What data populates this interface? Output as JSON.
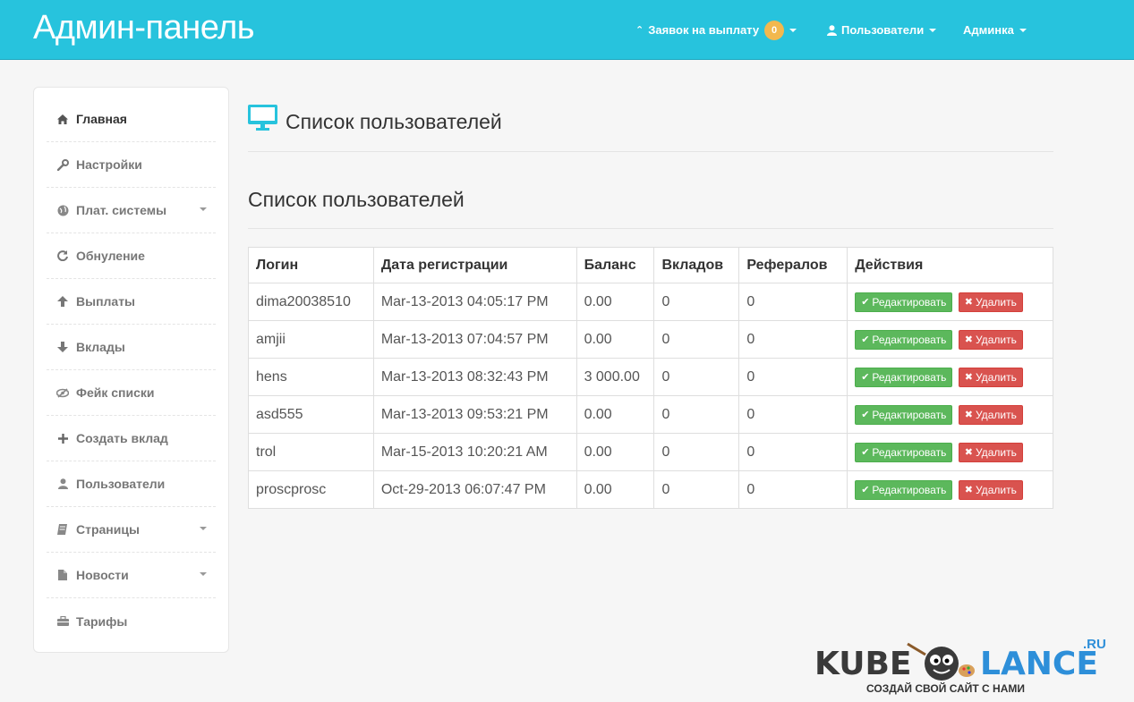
{
  "brand": "Админ-панель",
  "nav": {
    "payouts_label": "Заявок на выплату",
    "payouts_count": "0",
    "users_label": "Пользователи",
    "admin_label": "Админка"
  },
  "sidebar": {
    "items": [
      {
        "label": "Главная",
        "icon": "home-icon"
      },
      {
        "label": "Настройки",
        "icon": "wrench-icon"
      },
      {
        "label": "Плат. системы",
        "icon": "globe-icon"
      },
      {
        "label": "Обнуление",
        "icon": "refresh-icon"
      },
      {
        "label": "Выплаты",
        "icon": "arrow-up-icon"
      },
      {
        "label": "Вклады",
        "icon": "arrow-down-icon"
      },
      {
        "label": "Фейк списки",
        "icon": "eye-slash-icon"
      },
      {
        "label": "Создать вклад",
        "icon": "plus-icon"
      },
      {
        "label": "Пользователи",
        "icon": "user-icon"
      },
      {
        "label": "Страницы",
        "icon": "book-icon"
      },
      {
        "label": "Новости",
        "icon": "file-icon"
      },
      {
        "label": "Тарифы",
        "icon": "briefcase-icon"
      }
    ]
  },
  "main": {
    "page_title": "Список пользователей",
    "section_title": "Список пользователей",
    "table": {
      "headers": [
        "Логин",
        "Дата регистрации",
        "Баланс",
        "Вкладов",
        "Рефералов",
        "Действия"
      ],
      "edit_label": "Редактировать",
      "delete_label": "Удалить",
      "rows": [
        [
          "dima20038510",
          "Mar-13-2013 04:05:17 PM",
          "0.00",
          "0",
          "0"
        ],
        [
          "amjii",
          "Mar-13-2013 07:04:57 PM",
          "0.00",
          "0",
          "0"
        ],
        [
          "hens",
          "Mar-13-2013 08:32:43 PM",
          "3 000.00",
          "0",
          "0"
        ],
        [
          "asd555",
          "Mar-13-2013 09:53:21 PM",
          "0.00",
          "0",
          "0"
        ],
        [
          "trol",
          "Mar-15-2013 10:20:21 AM",
          "0.00",
          "0",
          "0"
        ],
        [
          "proscprosc",
          "Oct-29-2013 06:07:47 PM",
          "0.00",
          "0",
          "0"
        ]
      ]
    }
  },
  "watermark": {
    "left": "KUBE",
    "right": "LANCE",
    "domain": ".RU",
    "tagline": "СОЗДАЙ СВОЙ САЙТ С НАМИ"
  },
  "colors": {
    "navbar": "#27c3dd",
    "badge": "#f2b84e",
    "edit_button": "#5cb85c",
    "delete_button": "#d9534f"
  }
}
